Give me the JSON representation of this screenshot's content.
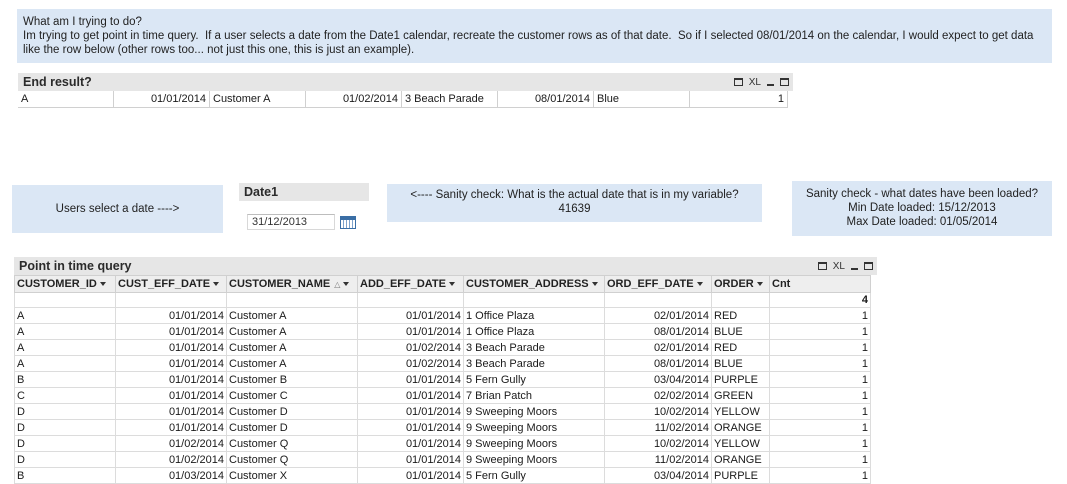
{
  "question": {
    "title": "What am I trying to do?",
    "body": "Im trying to get point in time query.  If a user selects a date from the Date1 calendar, recreate the customer rows as of that date.  So if I selected 08/01/2014 on the calendar, I would expect to get data like the row below (other rows too... not just this one, this is just an example)."
  },
  "end_result": {
    "title": "End result?",
    "xl_label": "XL",
    "row": [
      "A",
      "01/01/2014",
      "Customer A",
      "01/02/2014",
      "3 Beach Parade",
      "08/01/2014",
      "Blue",
      "1"
    ]
  },
  "users_select": {
    "text": "Users select a date  ---->"
  },
  "date1": {
    "title": "Date1",
    "value": "31/12/2013"
  },
  "sanity_var": {
    "line1": "<---- Sanity check: What is the actual date that is in my variable?",
    "line2": "41639"
  },
  "sanity_dates": {
    "line1": "Sanity check - what dates have been loaded?",
    "line2": "Min Date loaded: 15/12/2013",
    "line3": "Max Date loaded: 01/05/2014"
  },
  "pit": {
    "title": "Point in time query",
    "xl_label": "XL",
    "headers": [
      "CUSTOMER_ID",
      "CUST_EFF_DATE",
      "CUSTOMER_NAME",
      "ADD_EFF_DATE",
      "CUSTOMER_ADDRESS",
      "ORD_EFF_DATE",
      "ORDER",
      "Cnt"
    ],
    "total": "4",
    "rows": [
      [
        "A",
        "01/01/2014",
        "Customer A",
        "01/01/2014",
        "1 Office Plaza",
        "02/01/2014",
        "RED",
        "1"
      ],
      [
        "A",
        "01/01/2014",
        "Customer A",
        "01/01/2014",
        "1 Office Plaza",
        "08/01/2014",
        "BLUE",
        "1"
      ],
      [
        "A",
        "01/01/2014",
        "Customer A",
        "01/02/2014",
        "3 Beach Parade",
        "02/01/2014",
        "RED",
        "1"
      ],
      [
        "A",
        "01/01/2014",
        "Customer A",
        "01/02/2014",
        "3 Beach Parade",
        "08/01/2014",
        "BLUE",
        "1"
      ],
      [
        "B",
        "01/01/2014",
        "Customer B",
        "01/01/2014",
        "5 Fern Gully",
        "03/04/2014",
        "PURPLE",
        "1"
      ],
      [
        "C",
        "01/01/2014",
        "Customer C",
        "01/01/2014",
        "7 Brian Patch",
        "02/02/2014",
        "GREEN",
        "1"
      ],
      [
        "D",
        "01/01/2014",
        "Customer D",
        "01/01/2014",
        "9 Sweeping Moors",
        "10/02/2014",
        "YELLOW",
        "1"
      ],
      [
        "D",
        "01/01/2014",
        "Customer D",
        "01/01/2014",
        "9 Sweeping Moors",
        "11/02/2014",
        "ORANGE",
        "1"
      ],
      [
        "D",
        "01/02/2014",
        "Customer Q",
        "01/01/2014",
        "9 Sweeping Moors",
        "10/02/2014",
        "YELLOW",
        "1"
      ],
      [
        "D",
        "01/02/2014",
        "Customer Q",
        "01/01/2014",
        "9 Sweeping Moors",
        "11/02/2014",
        "ORANGE",
        "1"
      ],
      [
        "B",
        "01/03/2014",
        "Customer X",
        "01/01/2014",
        "5 Fern Gully",
        "03/04/2014",
        "PURPLE",
        "1"
      ]
    ]
  }
}
